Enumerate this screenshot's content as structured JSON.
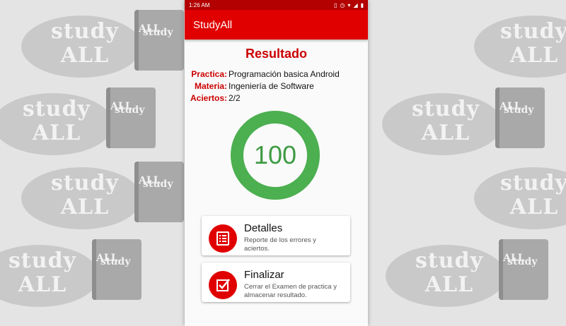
{
  "background": {
    "logo_top": "study",
    "logo_bottom": "ALL",
    "book_top": "study",
    "book_bottom": "ALL"
  },
  "status_bar": {
    "time": "1:26 AM"
  },
  "app_bar": {
    "title": "StudyAll"
  },
  "result": {
    "title": "Resultado",
    "practice_label": "Practica:",
    "practice_value": "Programación basica Android",
    "subject_label": "Materia:",
    "subject_value": "Ingeniería de Software",
    "hits_label": "Aciertos:",
    "hits_value": "2/2",
    "score": "100",
    "score_fraction": 1.0
  },
  "cards": {
    "details": {
      "title": "Detalles",
      "desc_line1": "Reporte de los errores y",
      "desc_line2": "aciertos."
    },
    "finish": {
      "title": "Finalizar",
      "desc_line1": "Cerrar el Examen de practica y",
      "desc_line2": "almacenar resultado."
    }
  },
  "colors": {
    "primary": "#e00000",
    "primary_dark": "#b30000",
    "accent_green": "#4caf50"
  }
}
